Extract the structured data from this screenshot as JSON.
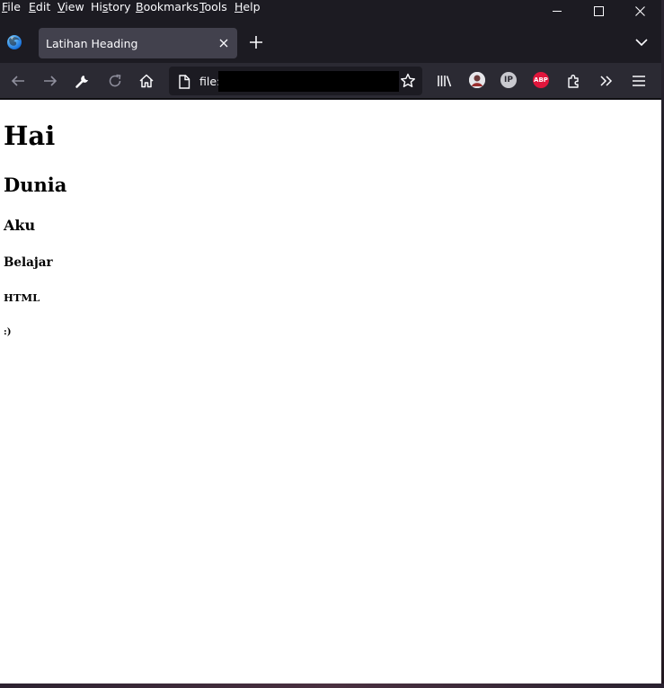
{
  "menubar": {
    "items": [
      {
        "pre": "",
        "u": "F",
        "post": "ile"
      },
      {
        "pre": "",
        "u": "E",
        "post": "dit"
      },
      {
        "pre": "",
        "u": "V",
        "post": "iew"
      },
      {
        "pre": "Hi",
        "u": "s",
        "post": "tory"
      },
      {
        "pre": "",
        "u": "B",
        "post": "ookmarks"
      },
      {
        "pre": "",
        "u": "T",
        "post": "ools"
      },
      {
        "pre": "",
        "u": "H",
        "post": "elp"
      }
    ]
  },
  "tab": {
    "title": "Latihan Heading"
  },
  "urlbar": {
    "text": "file:"
  },
  "extensions": {
    "ip_label": "IP",
    "abp_label": "ABP"
  },
  "page": {
    "h1": "Hai",
    "h2": "Dunia",
    "h3": "Aku",
    "h4": "Belajar",
    "h5": "HTML",
    "h6": ":)"
  },
  "colors": {
    "toolbar": "#2b2a33",
    "tab_selected": "#42414d",
    "abp_red": "#e0163c"
  }
}
